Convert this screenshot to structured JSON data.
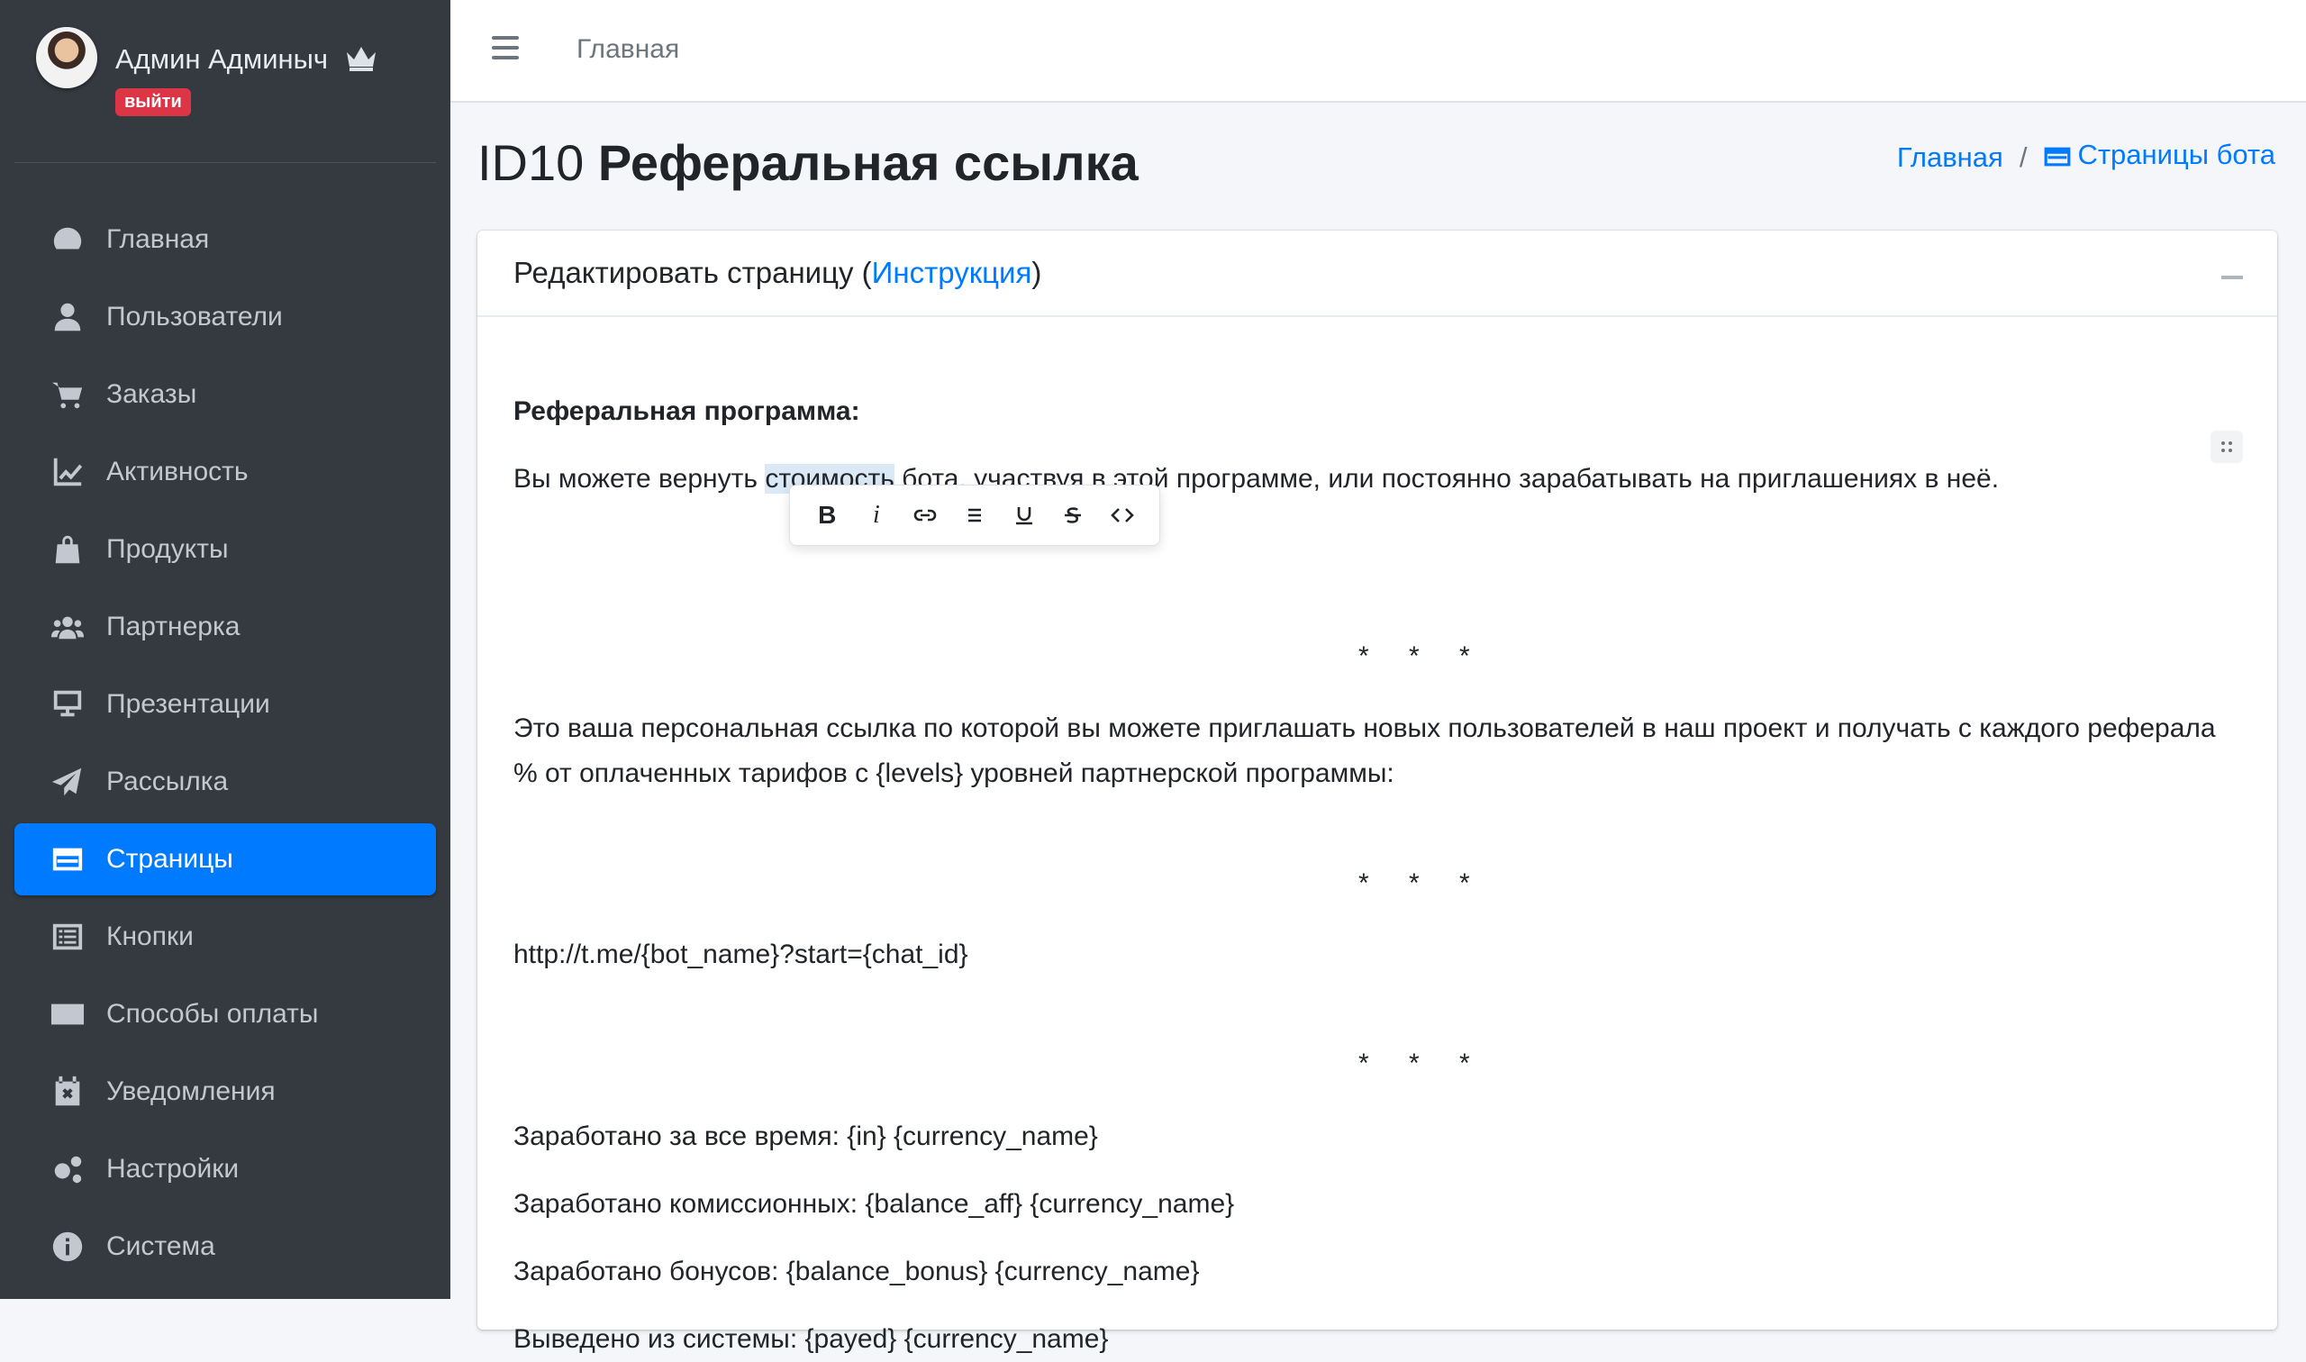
{
  "user": {
    "name": "Админ Админыч",
    "logout_label": "выйти"
  },
  "sidebar": {
    "items": [
      {
        "label": "Главная",
        "icon": "tachometer-icon"
      },
      {
        "label": "Пользователи",
        "icon": "user-icon"
      },
      {
        "label": "Заказы",
        "icon": "cart-icon"
      },
      {
        "label": "Активность",
        "icon": "chart-line-icon"
      },
      {
        "label": "Продукты",
        "icon": "bag-icon"
      },
      {
        "label": "Партнерка",
        "icon": "users-icon"
      },
      {
        "label": "Презентации",
        "icon": "presentation-icon"
      },
      {
        "label": "Рассылка",
        "icon": "paper-plane-icon"
      },
      {
        "label": "Страницы",
        "icon": "window-icon",
        "active": true
      },
      {
        "label": "Кнопки",
        "icon": "list-icon"
      },
      {
        "label": "Способы оплаты",
        "icon": "money-check-icon"
      },
      {
        "label": "Уведомления",
        "icon": "calendar-x-icon"
      },
      {
        "label": "Настройки",
        "icon": "cogs-icon"
      },
      {
        "label": "Система",
        "icon": "info-icon"
      }
    ]
  },
  "topbar": {
    "home_label": "Главная"
  },
  "page": {
    "id_prefix": "ID10",
    "title": "Реферальная ссылка"
  },
  "breadcrumb": {
    "home": "Главная",
    "sep": "/",
    "current": "Страницы бота"
  },
  "card": {
    "title_before": "Редактировать страницу (",
    "title_link": "Инструкция",
    "title_after": ")"
  },
  "editor": {
    "heading": "Реферальная программа:",
    "p1_before": "Вы можете вернуть ",
    "p1_selected": "стоимость",
    "p1_after": " бота, участвуя в этой программе, или постоянно зарабатывать на приглашениях в неё.",
    "separator": "* * *",
    "p2_line1": "Это ваша персональная ссылка по которой вы можете приглашать новых пользователей в наш проект и получать с каждого реферала",
    "p2_line2": "% от оплаченных тарифов с {levels} уровней партнерской программы:",
    "p3": "http://t.me/{bot_name}?start={chat_id}",
    "p4": "Заработано за все время: {in} {currency_name}",
    "p5": "Заработано комиссионных: {balance_aff} {currency_name}",
    "p6": "Заработано бонусов: {balance_bonus} {currency_name}",
    "p7": "Выведено из системы: {payed} {currency_name}"
  },
  "toolbar": {
    "bold": "B",
    "italic": "i"
  },
  "colors": {
    "sidebar_bg": "#343a40",
    "accent": "#007bff",
    "danger": "#dc3545"
  }
}
